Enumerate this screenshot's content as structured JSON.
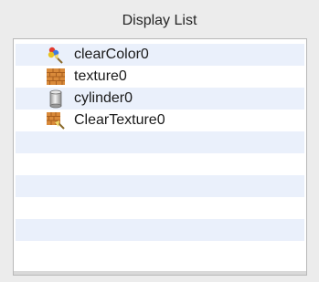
{
  "panel": {
    "title": "Display List"
  },
  "display_list": {
    "items": [
      {
        "label": "clearColor0",
        "icon": "clear-color-icon"
      },
      {
        "label": "texture0",
        "icon": "texture-icon"
      },
      {
        "label": "cylinder0",
        "icon": "cylinder-icon"
      },
      {
        "label": "ClearTexture0",
        "icon": "clear-texture-icon"
      }
    ]
  },
  "colors": {
    "row_alt": "#eaf0fb",
    "row": "#ffffff",
    "panel_bg": "#ececec"
  }
}
